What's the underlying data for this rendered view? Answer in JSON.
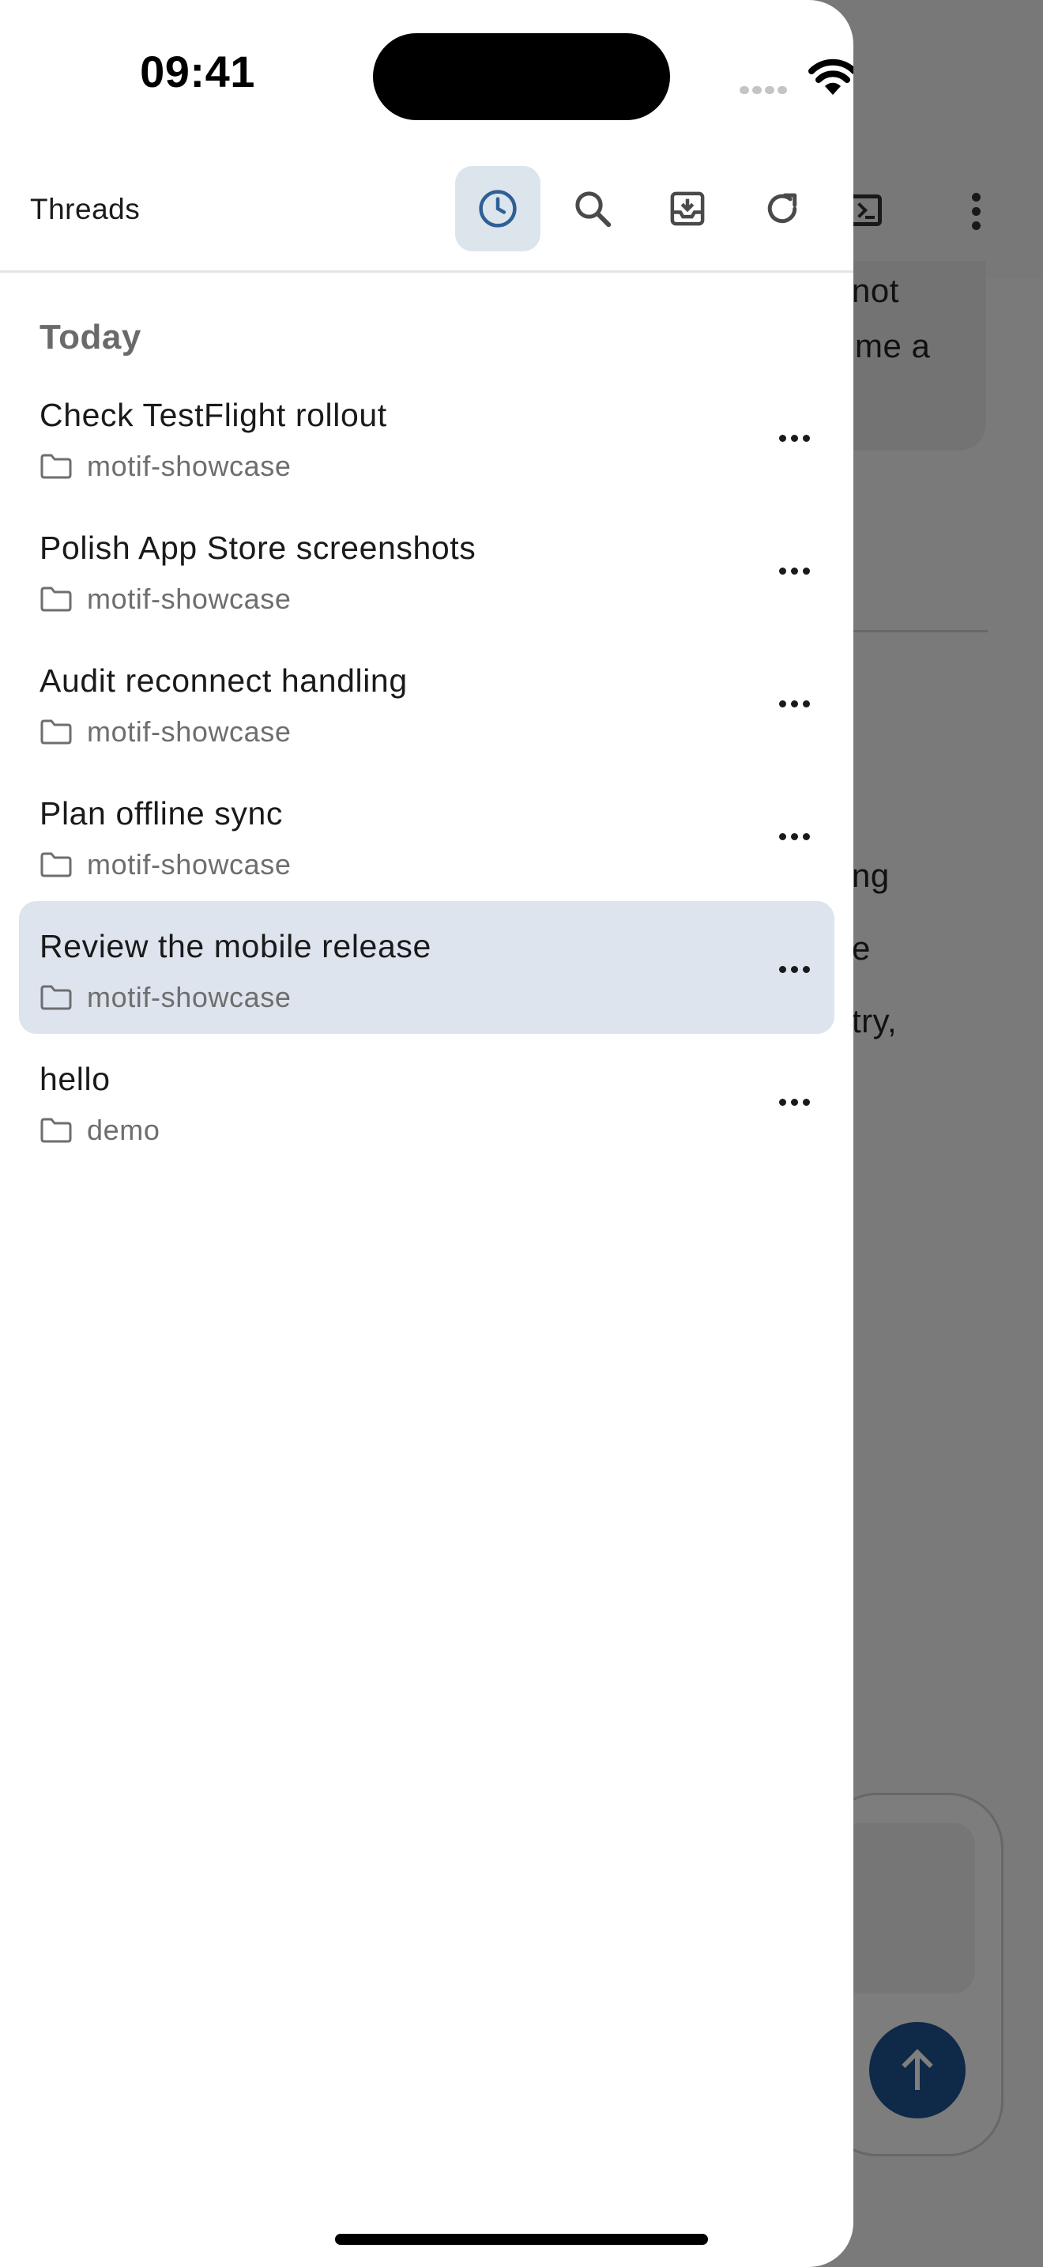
{
  "status_bar": {
    "time": "09:41"
  },
  "background": {
    "chat_fragments": [
      "not",
      "me a",
      "ng",
      "e",
      "try,"
    ]
  },
  "drawer": {
    "title": "Threads",
    "toolbar": [
      {
        "name": "history",
        "icon": "clock-icon",
        "active": true
      },
      {
        "name": "search",
        "icon": "search-icon",
        "active": false
      },
      {
        "name": "archive",
        "icon": "archive-icon",
        "active": false
      },
      {
        "name": "refresh",
        "icon": "refresh-icon",
        "active": false
      }
    ],
    "section_label": "Today",
    "threads": [
      {
        "title": "Check TestFlight rollout",
        "project": "motif-showcase",
        "selected": false
      },
      {
        "title": "Polish App Store screenshots",
        "project": "motif-showcase",
        "selected": false
      },
      {
        "title": "Audit reconnect handling",
        "project": "motif-showcase",
        "selected": false
      },
      {
        "title": "Plan offline sync",
        "project": "motif-showcase",
        "selected": false
      },
      {
        "title": "Review the mobile release",
        "project": "motif-showcase",
        "selected": true
      },
      {
        "title": "hello",
        "project": "demo",
        "selected": false
      }
    ]
  },
  "colors": {
    "accent": "#2e5f96",
    "selected_row": "#dde4ee",
    "active_tool_bg": "#dce4ec",
    "send_button": "#1f5390"
  }
}
